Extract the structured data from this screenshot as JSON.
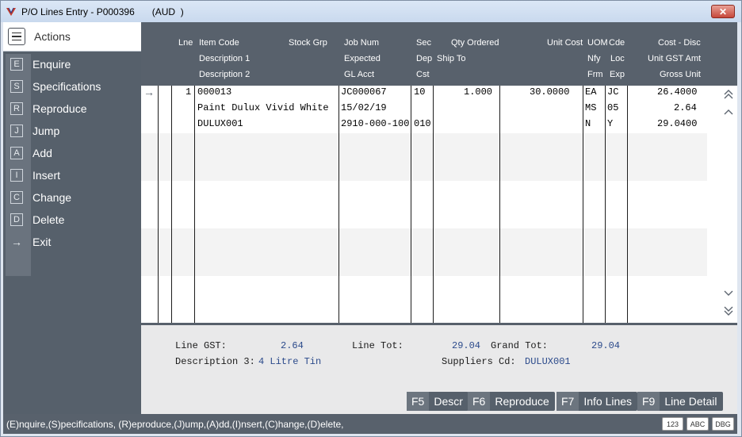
{
  "window": {
    "title": "P/O Lines Entry - P000396",
    "currency": "(AUD  )",
    "close_label": "✕"
  },
  "sidebar": {
    "header": "Actions",
    "items": [
      {
        "key": "E",
        "label": "Enquire"
      },
      {
        "key": "S",
        "label": "Specifications"
      },
      {
        "key": "R",
        "label": "Reproduce"
      },
      {
        "key": "J",
        "label": "Jump"
      },
      {
        "key": "A",
        "label": "Add"
      },
      {
        "key": "I",
        "label": "Insert"
      },
      {
        "key": "C",
        "label": "Change"
      },
      {
        "key": "D",
        "label": "Delete"
      },
      {
        "key": "→",
        "label": "Exit"
      }
    ]
  },
  "grid": {
    "headers": {
      "lne": "Lne",
      "item_code": "Item Code",
      "stock_grp": "Stock Grp",
      "job_num": "Job Num",
      "sec": "Sec",
      "qty_ordered": "Qty Ordered",
      "unit_cost": "Unit Cost",
      "uom": "UOM",
      "cde": "Cde",
      "cost_disc": "Cost - Disc",
      "description1": "Description 1",
      "expected": "Expected",
      "dep": "Dep",
      "ship_to": "Ship To",
      "nfy": "Nfy",
      "loc": "Loc",
      "unit_gst_amt": "Unit GST Amt",
      "description2": "Description 2",
      "gl_acct": "GL Acct",
      "cst": "Cst",
      "frm": "Frm",
      "exp": "Exp",
      "gross_unit": "Gross Unit"
    },
    "row": {
      "lne": "1",
      "item_code": "000013",
      "description1": "Paint Dulux Vivid White",
      "description2": "DULUX001",
      "job_num": "JC000067",
      "expected": "15/02/19",
      "gl_acct": "2910-000-100",
      "sec": "10",
      "cst": "010",
      "qty_ordered": "1.000",
      "unit_cost": "30.0000",
      "uom": "EA",
      "nfy": "MS",
      "frm": "N",
      "cde": "JC",
      "loc": "05",
      "exp": "Y",
      "cost_disc": "26.4000",
      "unit_gst_amt": "2.64",
      "gross_unit": "29.0400"
    }
  },
  "footer": {
    "line_gst_label": "Line GST:",
    "line_gst_value": "2.64",
    "line_tot_label": "Line Tot:",
    "line_tot_value": "29.04",
    "grand_tot_label": "Grand Tot:",
    "grand_tot_value": "29.04",
    "desc3_label": "Description 3:",
    "desc3_value": "4 Litre Tin",
    "suppliers_cd_label": "Suppliers Cd:",
    "suppliers_cd_value": "DULUX001"
  },
  "function_keys": [
    {
      "key": "F5",
      "label": "Descr"
    },
    {
      "key": "F6",
      "label": "Reproduce"
    },
    {
      "key": "F7",
      "label": "Info Lines"
    },
    {
      "key": "F9",
      "label": "Line Detail"
    }
  ],
  "statusbar": {
    "text": "(E)nquire,(S)pecifications, (R)eproduce,(J)ump,(A)dd,(I)nsert,(C)hange,(D)elete,",
    "badges": [
      "123",
      "ABC",
      "DBG"
    ]
  },
  "colors": {
    "header_bg": "#58616c",
    "sidebar_bg": "#56606b",
    "value_text": "#2b4a8b"
  }
}
